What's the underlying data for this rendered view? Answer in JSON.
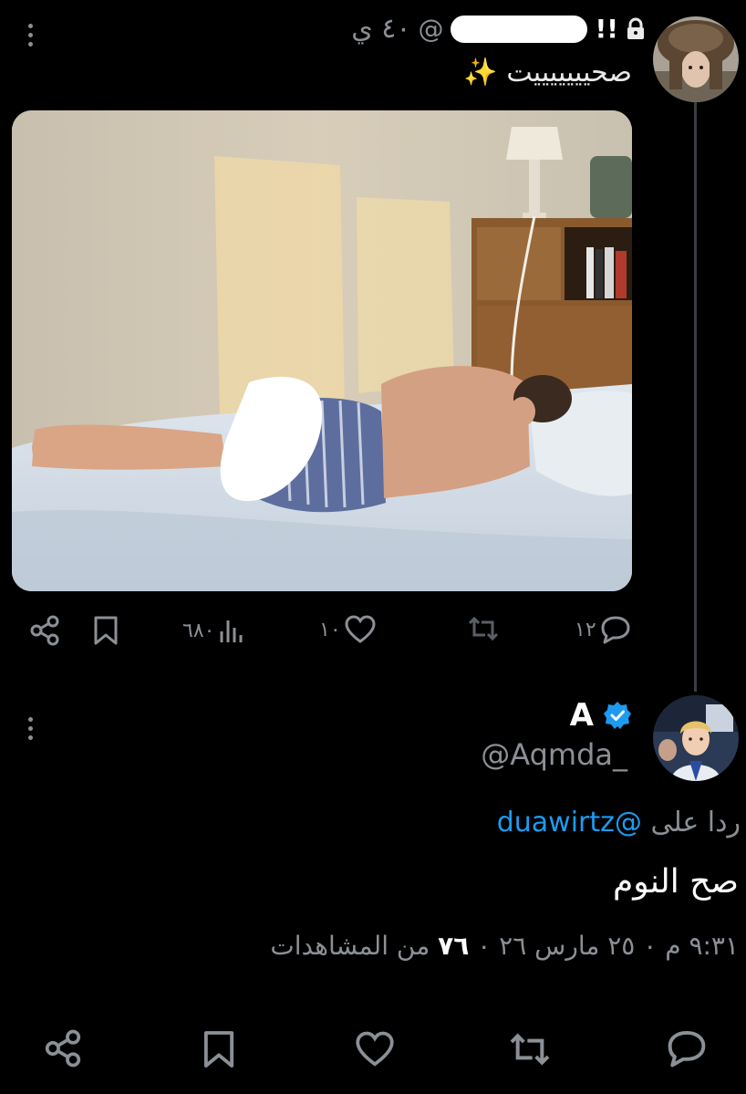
{
  "first_tweet": {
    "handle": "@",
    "time": "٤٠ ي",
    "name_suffix": "!!",
    "text": "صحيييييييت",
    "emoji": "✨",
    "actions": {
      "replies": "١٢",
      "likes": "١٠",
      "views": "٦٨٠"
    }
  },
  "second_tweet": {
    "name": "A",
    "handle": "@Aqmda_",
    "reply_prefix": "ردا على",
    "reply_mention": "@duawirtz",
    "text": "صح النوم",
    "meta_time": "٩:٣١ م ٠ ٢٥ مارس ٢٦ ٠",
    "meta_views_count": "٧٦",
    "meta_views_label": "من المشاهدات"
  },
  "icons": [
    "lock-icon",
    "verified-badge-icon",
    "reply-icon",
    "repost-icon",
    "like-icon",
    "views-icon",
    "bookmark-icon",
    "share-icon",
    "more-icon"
  ],
  "colors": {
    "background": "#000000",
    "muted_text": "#8b9096",
    "link": "#1d9bf0",
    "verified": "#1d9bf0"
  }
}
